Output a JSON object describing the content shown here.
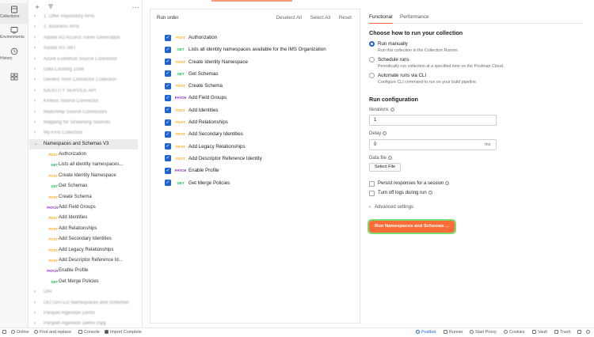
{
  "rail": {
    "items": [
      {
        "label": "Collections",
        "icon": "collections-icon"
      },
      {
        "label": "Environments",
        "icon": "environments-icon"
      },
      {
        "label": "History",
        "icon": "history-icon"
      },
      {
        "label": "",
        "icon": "apps-icon"
      }
    ]
  },
  "sidebar": {
    "collections_blurred": [
      "1. Offer Repository APIs",
      "2. Business APIs",
      "Adobe I/O Access Token Generation",
      "Adobe I/O JWT",
      "Azure Eventhub Source Connector",
      "Data Landing Zone",
      "Generic Rest Connector Collection",
      "IDENTITY SERVICE API",
      "Kinesis Source Connector",
      "Mailchimp Source Connectors",
      "Mapping for Streaming Sources",
      "My First Collection"
    ],
    "open_collection": "Namespaces and Schemas V3",
    "requests": [
      {
        "method": "POST",
        "name": "Authorization"
      },
      {
        "method": "GET",
        "name": "Lists all identity namespaces..."
      },
      {
        "method": "POST",
        "name": "Create Identity Namespace"
      },
      {
        "method": "GET",
        "name": "Get Schemas"
      },
      {
        "method": "POST",
        "name": "Create Schema"
      },
      {
        "method": "PATCH",
        "name": "Add Field Groups"
      },
      {
        "method": "POST",
        "name": "Add Identities"
      },
      {
        "method": "POST",
        "name": "Add Relationships"
      },
      {
        "method": "POST",
        "name": "Add Secondary Identities"
      },
      {
        "method": "POST",
        "name": "Add Legacy Relationships"
      },
      {
        "method": "POST",
        "name": "Add Descriptor Reference Id..."
      },
      {
        "method": "PATCH",
        "name": "Enable Profile"
      },
      {
        "method": "GET",
        "name": "Get Merge Policies"
      }
    ],
    "collections_after_blurred": [
      "OAI",
      "OUTDATED Namespaces and Schemas",
      "Parquet Ingestion Demo",
      "Parquet Ingestion Demo copy"
    ]
  },
  "run_order": {
    "title": "Run order",
    "deselect_all": "Deselect All",
    "select_all": "Select All",
    "reset": "Reset",
    "items": [
      {
        "method": "POST",
        "name": "Authorization",
        "checked": true
      },
      {
        "method": "GET",
        "name": "Lists all identity namespaces available for the IMS Organization",
        "checked": true
      },
      {
        "method": "POST",
        "name": "Create Identity Namespace",
        "checked": true
      },
      {
        "method": "GET",
        "name": "Get Schemas",
        "checked": true
      },
      {
        "method": "POST",
        "name": "Create Schema",
        "checked": true
      },
      {
        "method": "PATCH",
        "name": "Add Field Groups",
        "checked": true
      },
      {
        "method": "POST",
        "name": "Add Identities",
        "checked": true
      },
      {
        "method": "POST",
        "name": "Add Relationships",
        "checked": true
      },
      {
        "method": "POST",
        "name": "Add Secondary Identities",
        "checked": true
      },
      {
        "method": "POST",
        "name": "Add Legacy Relationships",
        "checked": true
      },
      {
        "method": "POST",
        "name": "Add Descriptor Reference Identity",
        "checked": true
      },
      {
        "method": "PATCH",
        "name": "Enable Profile",
        "checked": true
      },
      {
        "method": "GET",
        "name": "Get Merge Policies",
        "checked": true
      }
    ]
  },
  "config": {
    "tabs": [
      "Functional",
      "Performance"
    ],
    "choose_heading": "Choose how to run your collection",
    "options": [
      {
        "title": "Run manually",
        "desc": "Run this collection in the Collection Runner.",
        "selected": true
      },
      {
        "title": "Schedule runs",
        "desc": "Periodically run collection at a specified time on the Postman Cloud.",
        "selected": false
      },
      {
        "title": "Automate runs via CLI",
        "desc": "Configure CLI command to run on your build pipeline.",
        "selected": false
      }
    ],
    "run_config_heading": "Run configuration",
    "iterations_label": "Iterations",
    "iterations_value": "1",
    "delay_label": "Delay",
    "delay_value": "0",
    "delay_unit": "ms",
    "data_file_label": "Data file",
    "select_file": "Select File",
    "persist_label": "Persist responses for a session",
    "turn_off_logs_label": "Turn off logs during run",
    "advanced": "Advanced settings",
    "run_button": "Run Namespaces and Schemas ..."
  },
  "status_bar": {
    "online": "Online",
    "find_replace": "Find and replace",
    "console": "Console",
    "import_complete": "Import Complete",
    "postbot": "Postbot",
    "runner": "Runner",
    "start_proxy": "Start Proxy",
    "cookies": "Cookies",
    "vault": "Vault",
    "trash": "Trash"
  },
  "colors": {
    "accent": "#ff6c37",
    "checkbox": "#2063d0",
    "post": "#ffad1f",
    "get": "#0cbb52",
    "patch": "#912bdb"
  }
}
